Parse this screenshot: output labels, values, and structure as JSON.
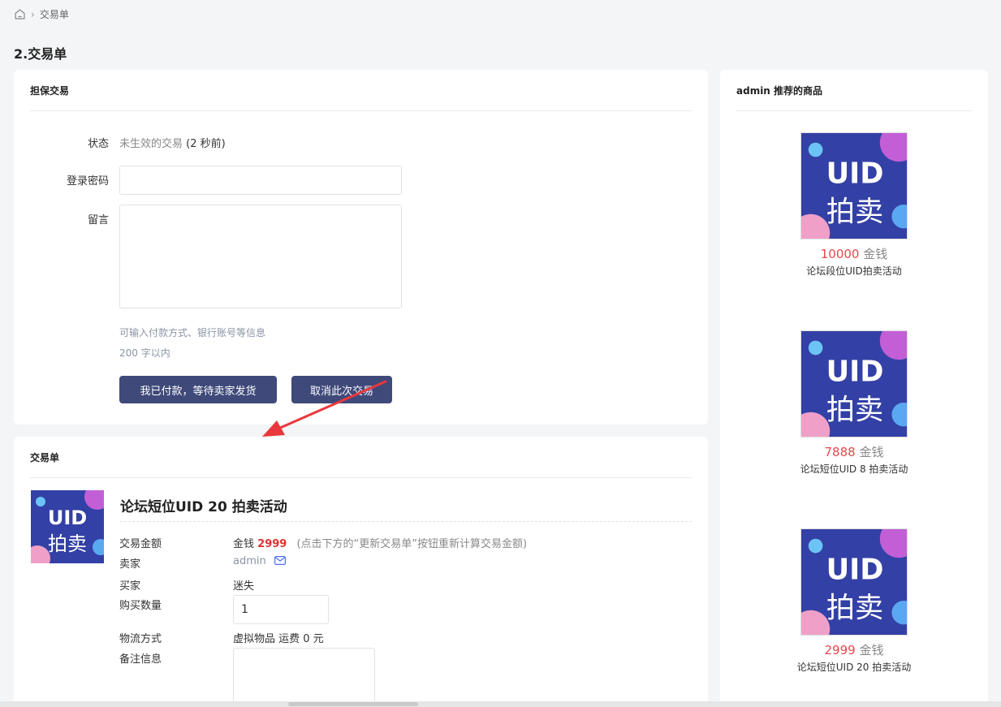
{
  "breadcrumb": {
    "current": "交易单"
  },
  "page_title": "2.交易单",
  "escrow": {
    "title": "担保交易",
    "status_label": "状态",
    "status_value": "未生效的交易",
    "status_time": "(2 秒前)",
    "password_label": "登录密码",
    "password_value": "",
    "message_label": "留言",
    "message_value": "",
    "hint1": "可输入付款方式、银行账号等信息",
    "hint2": "200 字以内",
    "paid_button": "我已付款，等待卖家发货",
    "cancel_button": "取消此次交易"
  },
  "order": {
    "title": "交易单",
    "product_title": "论坛短位UID 20 拍卖活动",
    "amount_label": "交易金额",
    "amount_currency": "金钱",
    "amount_value": "2999",
    "amount_note": "(点击下方的“更新交易单”按钮重新计算交易金额)",
    "seller_label": "卖家",
    "seller_value": "admin",
    "buyer_label": "买家",
    "buyer_value": "迷失",
    "quantity_label": "购买数量",
    "quantity_value": "1",
    "logistics_label": "物流方式",
    "logistics_value": "虚拟物品 运费 0 元",
    "remark_label": "备注信息",
    "remark_value": ""
  },
  "thumbnail": {
    "line1": "UID",
    "line2": "拍卖"
  },
  "recommend": {
    "title": "admin 推荐的商品",
    "items": [
      {
        "price": "10000",
        "unit": "金钱",
        "name": "论坛段位UID拍卖活动"
      },
      {
        "price": "7888",
        "unit": "金钱",
        "name": "论坛短位UID 8 拍卖活动"
      },
      {
        "price": "2999",
        "unit": "金钱",
        "name": "论坛短位UID 20 拍卖活动"
      }
    ]
  },
  "colors": {
    "button": "#3f4a7a",
    "price": "#e03131",
    "arrow": "#e8383d"
  },
  "icons": [
    "home-icon",
    "mail-icon",
    "red-arrow-annotation"
  ]
}
